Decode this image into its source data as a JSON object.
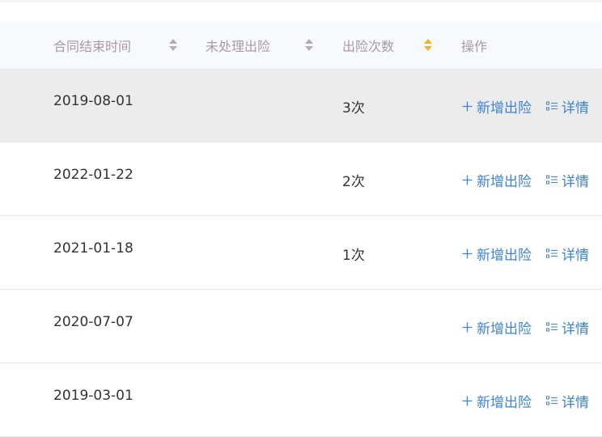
{
  "table": {
    "columns": [
      {
        "label": "合同结束时间",
        "sortable": true,
        "sort": "none"
      },
      {
        "label": "未处理出险",
        "sortable": true,
        "sort": "none"
      },
      {
        "label": "出险次数",
        "sortable": true,
        "sort": "active"
      },
      {
        "label": "操作",
        "sortable": false
      }
    ],
    "actions": {
      "add_claim": "新增出险",
      "details": "详情"
    },
    "rows": [
      {
        "end_date": "2019-08-01",
        "pending_claims": "",
        "claim_count": "3次",
        "highlighted": true
      },
      {
        "end_date": "2022-01-22",
        "pending_claims": "",
        "claim_count": "2次",
        "highlighted": false
      },
      {
        "end_date": "2021-01-18",
        "pending_claims": "",
        "claim_count": "1次",
        "highlighted": false
      },
      {
        "end_date": "2020-07-07",
        "pending_claims": "",
        "claim_count": "",
        "highlighted": false
      },
      {
        "end_date": "2019-03-01",
        "pending_claims": "",
        "claim_count": "",
        "highlighted": false
      }
    ]
  },
  "colors": {
    "header_text": "#a99aa6",
    "sort_active": "#f0b429",
    "link": "#3d83d6",
    "row_highlight": "#ececec"
  },
  "icons": {
    "add": "plus-icon",
    "details": "list-icon"
  }
}
